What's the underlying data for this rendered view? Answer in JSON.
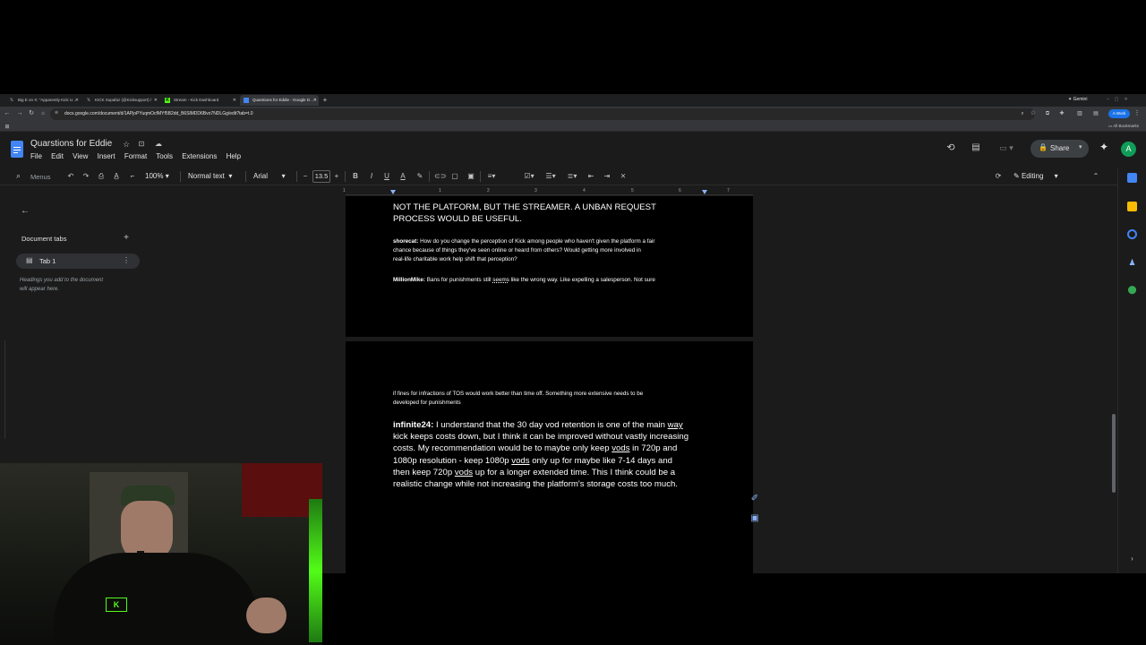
{
  "browser": {
    "tabs": [
      {
        "label": "Big E on X: \"Apparently Kick U…",
        "icon": "x-logo-icon"
      },
      {
        "label": "KICK Supafaz (@Kicksupport) /",
        "icon": "x-logo-icon"
      },
      {
        "label": "Stream - Kick Dashboard",
        "icon": "kick-logo-icon"
      },
      {
        "label": "Quarstions for Eddie - Google D…",
        "icon": "docs-icon"
      }
    ],
    "gemini_label": "Gemini",
    "url": "docs.google.com/document/d/1APjoPYuqmOcfMYf5B2dd_B6SlMDD6Bvo7NDLGg/edit?tab=t.0",
    "profile_label": "Work",
    "all_bookmarks": "All Bookmarks"
  },
  "doc": {
    "title": "Quarstions for Eddie",
    "menus": [
      "File",
      "Edit",
      "View",
      "Insert",
      "Format",
      "Tools",
      "Extensions",
      "Help"
    ],
    "share_label": "Share",
    "avatar_letter": "A",
    "editing_label": "Editing"
  },
  "toolbar": {
    "search_menus": "Menus",
    "zoom": "100%",
    "style": "Normal text",
    "font": "Arial",
    "font_size": "13.5"
  },
  "ruler": {
    "ticks": [
      "1",
      "1",
      "2",
      "3",
      "4",
      "5",
      "6",
      "7"
    ]
  },
  "sidebar": {
    "title": "Document tabs",
    "tab_label": "Tab 1",
    "hint_line1": "Headings you add to the document",
    "hint_line2": "will appear here."
  },
  "page1": {
    "heading_line1": "NOT THE PLATFORM, BUT THE STREAMER. A UNBAN REQUEST",
    "heading_line2": "PROCESS WOULD BE USEFUL.",
    "q1_name": "shorecat:",
    "q1_line1": " How do you change the perception of Kick among people who haven't given the platform a fair",
    "q1_line2": "chance because of things they've seen online or heard from others? Would getting more involved in",
    "q1_line3": "real-life charitable work help shift that perception?",
    "q2_name": "MillionMike:",
    "q2_pre": " Bans for punishments still ",
    "q2_word": "seems",
    "q2_post": " like the wrong way. Like expelling a salesperson. Not sure"
  },
  "page2": {
    "p1_line1": "if fines for infractions of TOS would work better than time off. Something more extensive needs to be",
    "p1_line2": "developed for punishments",
    "q3_name": "infinite24:",
    "l1_a": " I understand that the 30 day vod retention is one of the main ",
    "l1_u": "way",
    "l2": "kick keeps costs down, but I think it can be improved without vastly increasing",
    "l3_a": "costs. My recommendation would be to maybe only keep ",
    "l3_u": "vods",
    "l3_b": " in 720p and",
    "l4_a": "1080p resolution - keep 1080p ",
    "l4_u": "vods",
    "l4_b": " only up for maybe like 7-14 days and",
    "l5_a": "then keep 720p ",
    "l5_u": "vods",
    "l5_b": " up for a longer extended time. This I think could be a",
    "l6": "realistic change while not increasing the platform's storage costs too much."
  },
  "colors": {
    "accent": "#8ab4f8",
    "doc_blue": "#4285f4",
    "kick_green": "#53fc18"
  }
}
